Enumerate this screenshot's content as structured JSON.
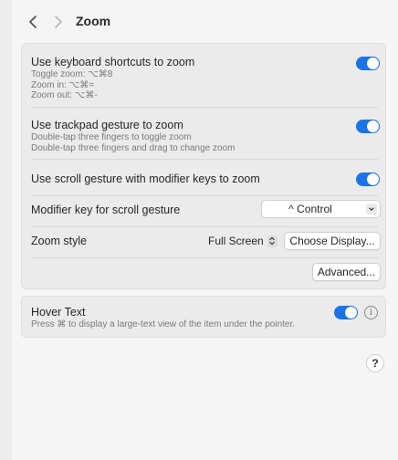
{
  "toolbar": {
    "back_glyph": "<",
    "forward_glyph": ">",
    "title": "Zoom"
  },
  "keyboard_shortcuts": {
    "title": "Use keyboard shortcuts to zoom",
    "lines": [
      "Toggle zoom: ⌥⌘8",
      "Zoom in: ⌥⌘=",
      "Zoom out: ⌥⌘-"
    ],
    "enabled": true
  },
  "trackpad_gesture": {
    "title": "Use trackpad gesture to zoom",
    "lines": [
      "Double-tap three fingers to toggle zoom",
      "Double-tap three fingers and drag to change zoom"
    ],
    "enabled": true
  },
  "scroll_gesture": {
    "title": "Use scroll gesture with modifier keys to zoom",
    "enabled": true
  },
  "modifier_key": {
    "label": "Modifier key for scroll gesture",
    "value": "^ Control"
  },
  "zoom_style": {
    "label": "Zoom style",
    "value": "Full Screen",
    "choose_display_label": "Choose Display..."
  },
  "advanced_label": "Advanced...",
  "hover_text": {
    "title": "Hover Text",
    "subtitle": "Press ⌘ to display a large-text view of the item under the pointer.",
    "enabled": true,
    "info_glyph": "i"
  },
  "help_glyph": "?",
  "colors": {
    "accent": "#1a73e8",
    "window_bg": "#f5f5f5",
    "panel_bg": "#ebebeb"
  }
}
